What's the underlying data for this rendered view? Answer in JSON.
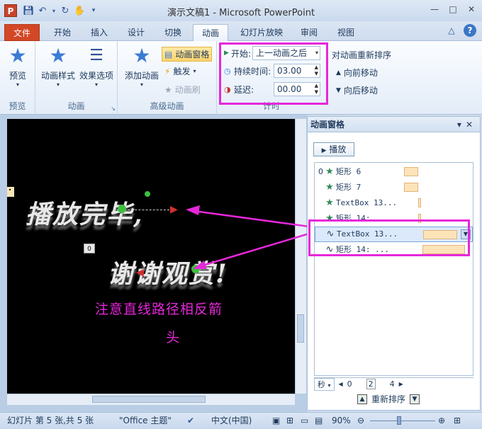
{
  "window": {
    "title": "演示文稿1 - Microsoft PowerPoint",
    "app_logo": "P"
  },
  "tabs": [
    {
      "label": "文件"
    },
    {
      "label": "开始"
    },
    {
      "label": "插入"
    },
    {
      "label": "设计"
    },
    {
      "label": "切换"
    },
    {
      "label": "动画"
    },
    {
      "label": "幻灯片放映"
    },
    {
      "label": "审阅"
    },
    {
      "label": "视图"
    }
  ],
  "ribbon": {
    "preview": {
      "label": "预览",
      "group": "预览"
    },
    "animation": {
      "style_label": "动画样式",
      "effect_label": "效果选项",
      "group": "动画"
    },
    "advanced": {
      "add_label": "添加动画",
      "pane_label": "动画窗格",
      "trigger_label": "触发",
      "painter_label": "动画刷",
      "group": "高级动画"
    },
    "timing": {
      "start_label": "开始:",
      "start_value": "上一动画之后",
      "duration_label": "持续时间:",
      "duration_value": "03.00",
      "delay_label": "延迟:",
      "delay_value": "00.00",
      "group": "计时"
    },
    "reorder": {
      "title": "对动画重新排序",
      "forward": "向前移动",
      "backward": "向后移动"
    }
  },
  "slide": {
    "line1": "播放完毕,",
    "line2": "谢谢观赏!",
    "note_line1": "注意直线路径相反箭",
    "note_line2": "头",
    "tag": "0"
  },
  "pane": {
    "title": "动画窗格",
    "play_label": "播放",
    "items": [
      {
        "num": "0",
        "label": "矩形 6"
      },
      {
        "num": "",
        "label": "矩形 7"
      },
      {
        "num": "",
        "label": "TextBox 13..."
      },
      {
        "num": "",
        "label": "矩形 14: ..."
      },
      {
        "num": "",
        "label": "TextBox 13..."
      },
      {
        "num": "",
        "label": "矩形 14: ..."
      }
    ],
    "timeline_unit": "秒",
    "timeline_ticks": [
      "0",
      "2",
      "4"
    ],
    "reorder_label": "重新排序"
  },
  "status": {
    "slide_info": "幻灯片 第 5 张,共 5 张",
    "theme": "\"Office 主题\"",
    "language": "中文(中国)",
    "zoom": "90%"
  }
}
